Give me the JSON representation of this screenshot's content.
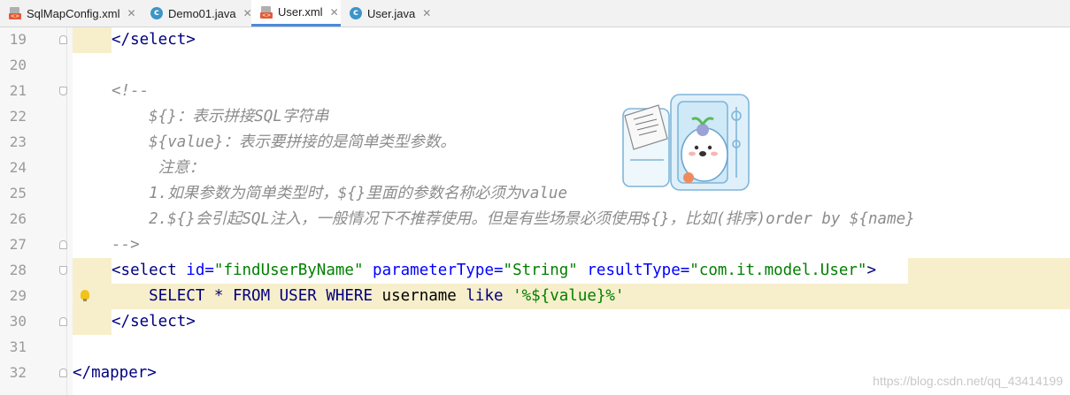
{
  "tabs": [
    {
      "label": "SqlMapConfig.xml",
      "icon": "xml-file-icon",
      "active": false
    },
    {
      "label": "Demo01.java",
      "icon": "java-class-icon",
      "active": false
    },
    {
      "label": "User.xml",
      "icon": "xml-file-icon",
      "active": true
    },
    {
      "label": "User.java",
      "icon": "java-class-icon",
      "active": false
    }
  ],
  "editor": {
    "lines": [
      {
        "num": "19",
        "segments": [
          {
            "t": "</select>",
            "c": "tag"
          }
        ]
      },
      {
        "num": "20",
        "segments": []
      },
      {
        "num": "21",
        "segments": [
          {
            "t": "<!--",
            "c": "cmt"
          }
        ]
      },
      {
        "num": "22",
        "segments": [
          {
            "t": "    ${}：表示拼接SQL字符串",
            "c": "cmt"
          }
        ]
      },
      {
        "num": "23",
        "segments": [
          {
            "t": "    ${value}：表示要拼接的是简单类型参数。",
            "c": "cmt"
          }
        ]
      },
      {
        "num": "24",
        "segments": [
          {
            "t": "     注意：",
            "c": "cmt"
          }
        ]
      },
      {
        "num": "25",
        "segments": [
          {
            "t": "    1.如果参数为简单类型时，${}里面的参数名称必须为value",
            "c": "cmt"
          }
        ]
      },
      {
        "num": "26",
        "segments": [
          {
            "t": "    2.${}会引起SQL注入，一般情况下不推荐使用。但是有些场景必须使用${}，比如(排序)order by ${name}",
            "c": "cmt"
          }
        ]
      },
      {
        "num": "27",
        "segments": [
          {
            "t": "-->",
            "c": "cmt"
          }
        ]
      },
      {
        "num": "28",
        "segments": [
          {
            "t": "<select ",
            "c": "tag"
          },
          {
            "t": "id=",
            "c": "attr"
          },
          {
            "t": "\"findUserByName\" ",
            "c": "str"
          },
          {
            "t": "parameterType=",
            "c": "attr"
          },
          {
            "t": "\"String\" ",
            "c": "str"
          },
          {
            "t": "resultType=",
            "c": "attr"
          },
          {
            "t": "\"com.it.model.User\"",
            "c": "str"
          },
          {
            "t": ">",
            "c": "tag"
          }
        ]
      },
      {
        "num": "29",
        "segments": [
          {
            "t": "    SELECT * FROM USER WHERE ",
            "c": "kw"
          },
          {
            "t": "username ",
            "c": "plain"
          },
          {
            "t": "like ",
            "c": "kw"
          },
          {
            "t": "'%${value}%'",
            "c": "str"
          }
        ]
      },
      {
        "num": "30",
        "segments": [
          {
            "t": "</select>",
            "c": "tag"
          }
        ]
      },
      {
        "num": "31",
        "segments": []
      },
      {
        "num": "32",
        "segments": [
          {
            "t": "</mapper>",
            "c": "tag"
          }
        ]
      }
    ]
  },
  "watermark": "https://blog.csdn.net/qq_43414199",
  "colors": {
    "accent": "#4b89dc",
    "tag": "#000080",
    "attr": "#0000ff",
    "string": "#008000",
    "comment": "#8c8c8c",
    "highlight": "#f7efcb"
  }
}
